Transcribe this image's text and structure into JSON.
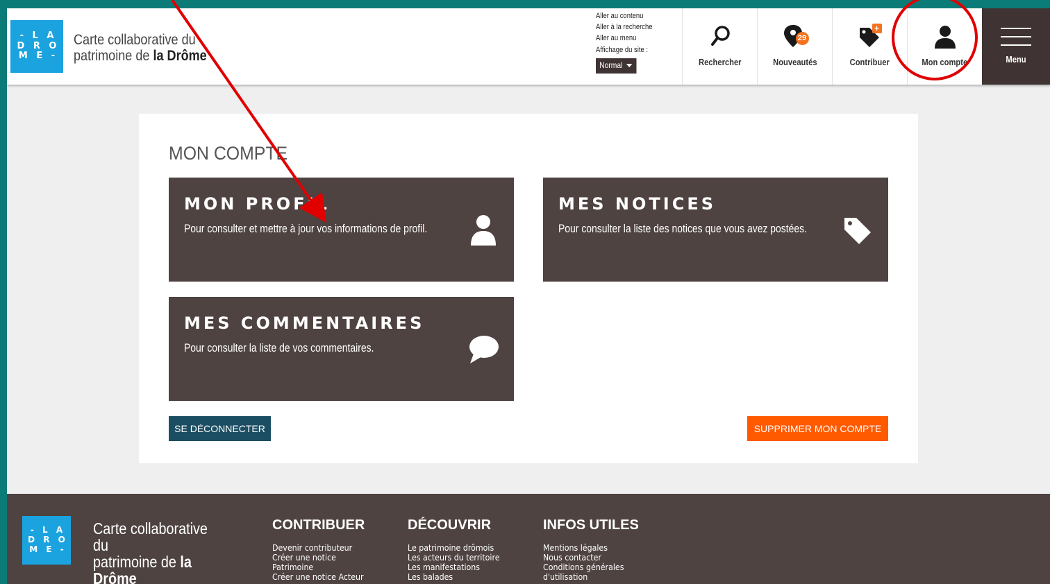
{
  "header": {
    "logo_lines": [
      "- L A",
      "D R O",
      "M E -"
    ],
    "title_line1": "Carte collaborative du",
    "title_line2_prefix": "patrimoine de ",
    "title_line2_bold": "la Drôme",
    "skip_links": [
      "Aller au contenu",
      "Aller à la recherche",
      "Aller au menu"
    ],
    "display_label": "Affichage du site :",
    "display_value": "Normal",
    "nav": {
      "search": "Rechercher",
      "new": "Nouveautés",
      "new_badge": "29",
      "contribute": "Contribuer",
      "account": "Mon compte",
      "menu": "Menu"
    }
  },
  "main": {
    "title": "MON COMPTE",
    "tiles": [
      {
        "title": "MON PROFIL",
        "desc": "Pour consulter et mettre à jour vos informations de profil.",
        "icon": "user-icon"
      },
      {
        "title": "MES NOTICES",
        "desc": "Pour consulter la liste des notices que vous avez postées.",
        "icon": "tag-icon"
      },
      {
        "title": "MES COMMENTAIRES",
        "desc": "Pour consulter la liste de vos commentaires.",
        "icon": "speech-bubble-icon"
      }
    ],
    "logout": "SE DÉCONNECTER",
    "delete": "SUPPRIMER MON COMPTE"
  },
  "footer": {
    "logo_lines": [
      "- L A",
      "D R O",
      "M E -"
    ],
    "title_line1": "Carte collaborative du",
    "title_line2_prefix": "patrimoine de ",
    "title_line2_bold": "la",
    "title_line3_bold": "Drôme",
    "columns": [
      {
        "heading": "CONTRIBUER",
        "items": [
          "Devenir contributeur",
          "Créer une notice",
          "Patrimoine",
          "Créer une notice Acteur"
        ]
      },
      {
        "heading": "DÉCOUVRIR",
        "items": [
          "Le patrimoine drômois",
          "Les acteurs du territoire",
          "Les manifestations",
          "Les balades"
        ]
      },
      {
        "heading": "INFOS UTILES",
        "items": [
          "Mentions légales",
          "Nous contacter",
          "Conditions générales",
          "d'utilisation"
        ]
      }
    ]
  },
  "colors": {
    "frame": "#0b7b78",
    "tile": "#4e4341",
    "logo_blue": "#1ba3e0",
    "accent_orange": "#ff5a00",
    "logout_blue": "#1c4e63",
    "annotation_red": "#e00000"
  }
}
